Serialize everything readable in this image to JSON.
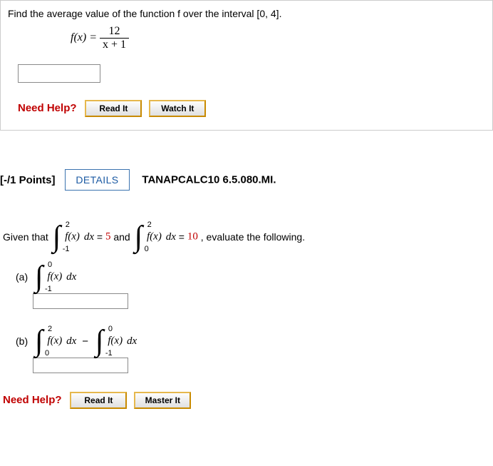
{
  "q1": {
    "prompt": "Find the average value of the function f over the interval [0, 4].",
    "func_lhs": "f(x) =",
    "frac_num": "12",
    "frac_den": "x + 1",
    "need_help": "Need Help?",
    "read_btn": "Read It",
    "watch_btn": "Watch It"
  },
  "header": {
    "points": "[-/1 Points]",
    "details": "DETAILS",
    "ref": "TANAPCALC10 6.5.080.MI."
  },
  "q2": {
    "given_pre": "Given that ",
    "int1": {
      "lower": "-1",
      "upper": "2",
      "body": "f(x)",
      "dx": "dx",
      "eq": " = ",
      "val": "5"
    },
    "and": " and ",
    "int2": {
      "lower": "0",
      "upper": "2",
      "body": "f(x)",
      "dx": "dx",
      "eq": " = ",
      "val": "10"
    },
    "given_post": ", evaluate the following.",
    "a": {
      "label": "(a)",
      "int": {
        "lower": "-1",
        "upper": "0",
        "body": "f(x)",
        "dx": "dx"
      }
    },
    "b": {
      "label": "(b)",
      "int1": {
        "lower": "0",
        "upper": "2",
        "body": "f(x)",
        "dx": "dx"
      },
      "minus": "−",
      "int2": {
        "lower": "-1",
        "upper": "0",
        "body": "f(x)",
        "dx": "dx"
      }
    },
    "need_help": "Need Help?",
    "read_btn": "Read It",
    "master_btn": "Master It"
  }
}
